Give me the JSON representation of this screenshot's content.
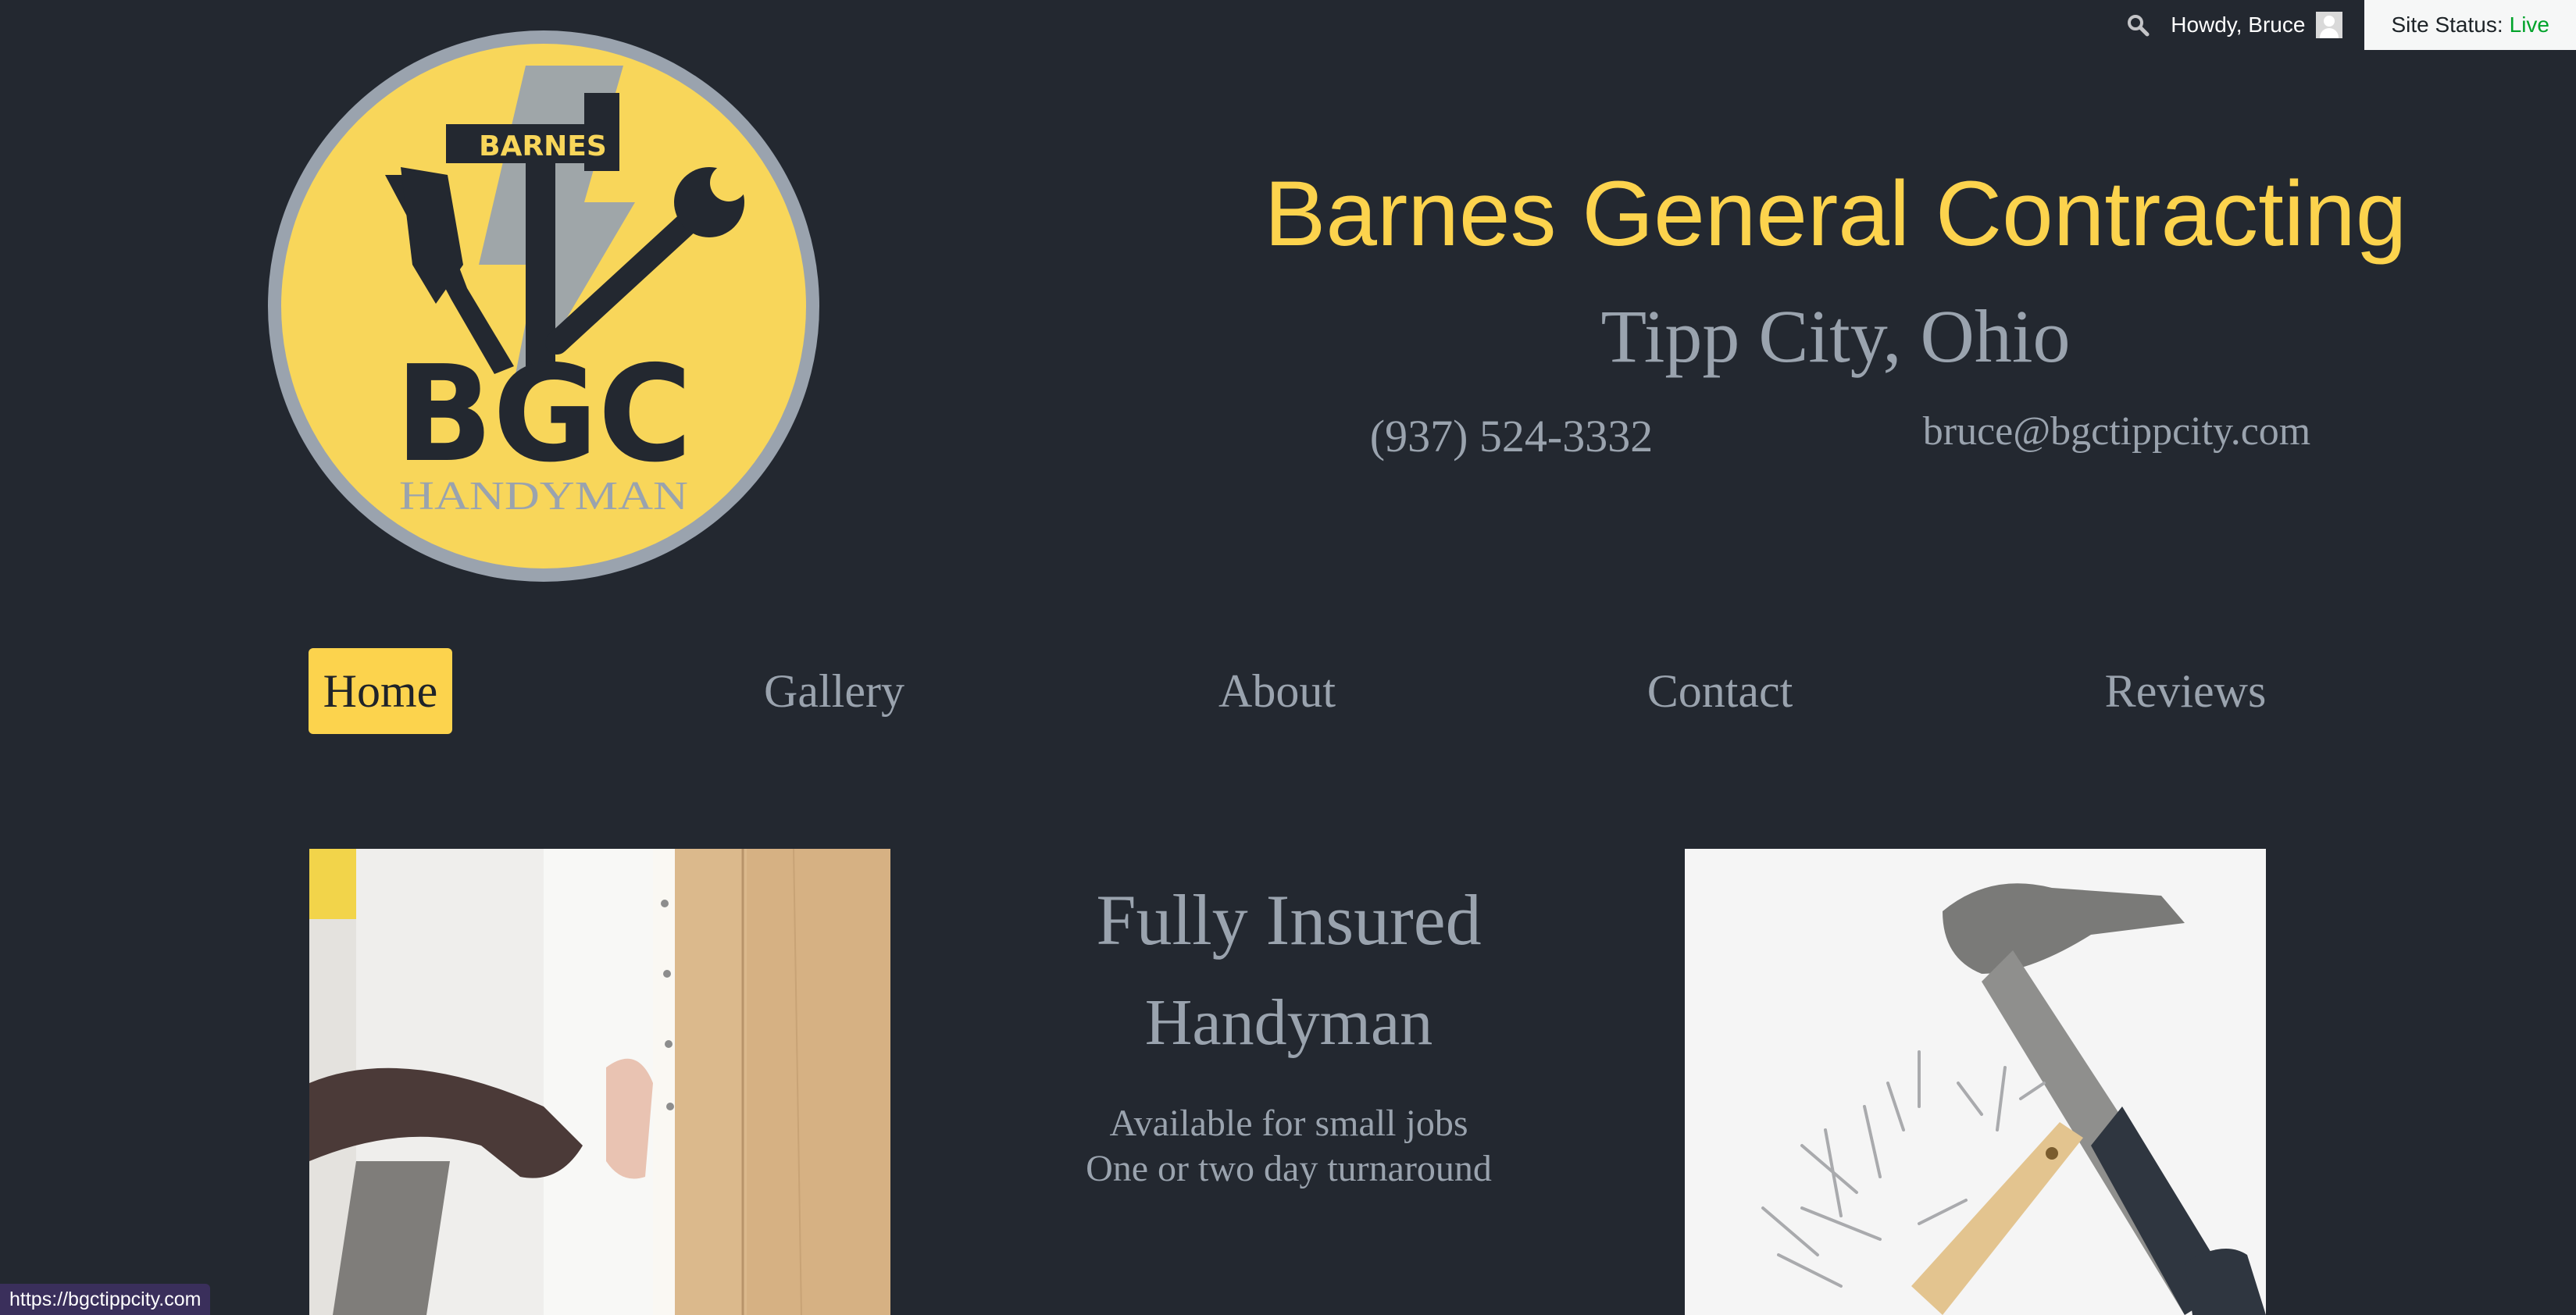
{
  "admin_bar": {
    "greeting": "Howdy, Bruce",
    "site_status_label": "Site Status:",
    "site_status_value": "Live"
  },
  "logo": {
    "top_text": "BARNES",
    "main_text": "BGC",
    "bottom_text": "HANDYMAN"
  },
  "header": {
    "title": "Barnes General Contracting",
    "subtitle": "Tipp City, Ohio",
    "phone": "(937) 524-3332",
    "email": "bruce@bgctippcity.com"
  },
  "nav": {
    "items": [
      {
        "label": "Home"
      },
      {
        "label": "Gallery"
      },
      {
        "label": "About"
      },
      {
        "label": "Contact"
      },
      {
        "label": "Reviews"
      }
    ]
  },
  "hero": {
    "heading": "Fully Insured",
    "subheading": "Handyman",
    "line1": "Available for small jobs",
    "line2": "One or two day turnaround"
  },
  "status_bar": {
    "url": "https://bgctippcity.com"
  },
  "colors": {
    "background": "#232830",
    "accent_yellow": "#fcd34d",
    "text_gray": "#9aa3ae",
    "status_live": "#00a32a"
  },
  "icons": {
    "admin_search": "search-icon",
    "admin_avatar": "user-avatar-icon"
  }
}
